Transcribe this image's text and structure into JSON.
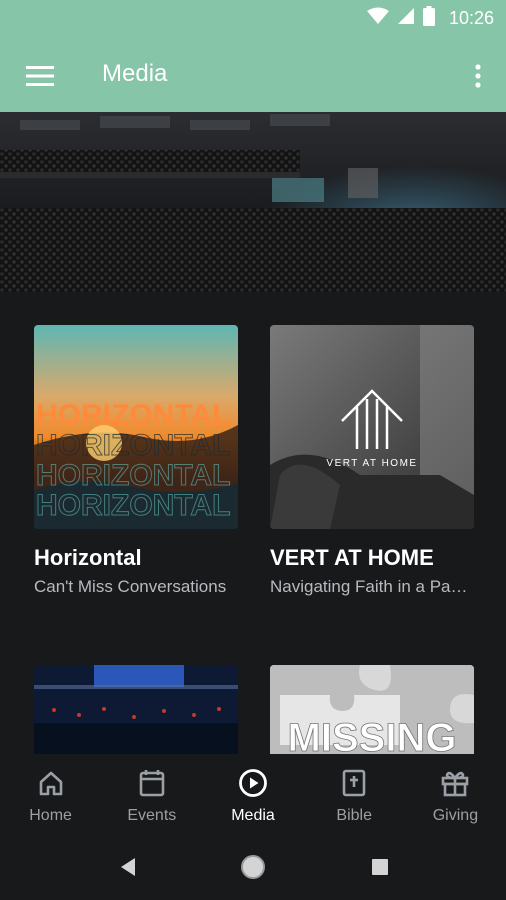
{
  "status": {
    "time": "10:26"
  },
  "appbar": {
    "title": "Media"
  },
  "cards": [
    {
      "title": "Horizontal",
      "subtitle": "Can't Miss Conversations",
      "art_text": "HORIZONTAL"
    },
    {
      "title": "VERT AT HOME",
      "subtitle": "Navigating Faith in a Pandemic",
      "art_text": "VERT AT HOME"
    },
    {
      "title": "",
      "subtitle": ""
    },
    {
      "title": "",
      "subtitle": "",
      "art_text": "MISSING"
    }
  ],
  "bottom_nav": [
    {
      "label": "Home",
      "icon": "home-icon"
    },
    {
      "label": "Events",
      "icon": "calendar-icon"
    },
    {
      "label": "Media",
      "icon": "play-circle-icon",
      "active": true
    },
    {
      "label": "Bible",
      "icon": "bible-icon"
    },
    {
      "label": "Giving",
      "icon": "gift-icon"
    }
  ],
  "colors": {
    "accent": "#86c5a8",
    "background": "#17191b",
    "subtitle": "#b7bbbf",
    "nav_inactive": "#9aa0a5"
  }
}
